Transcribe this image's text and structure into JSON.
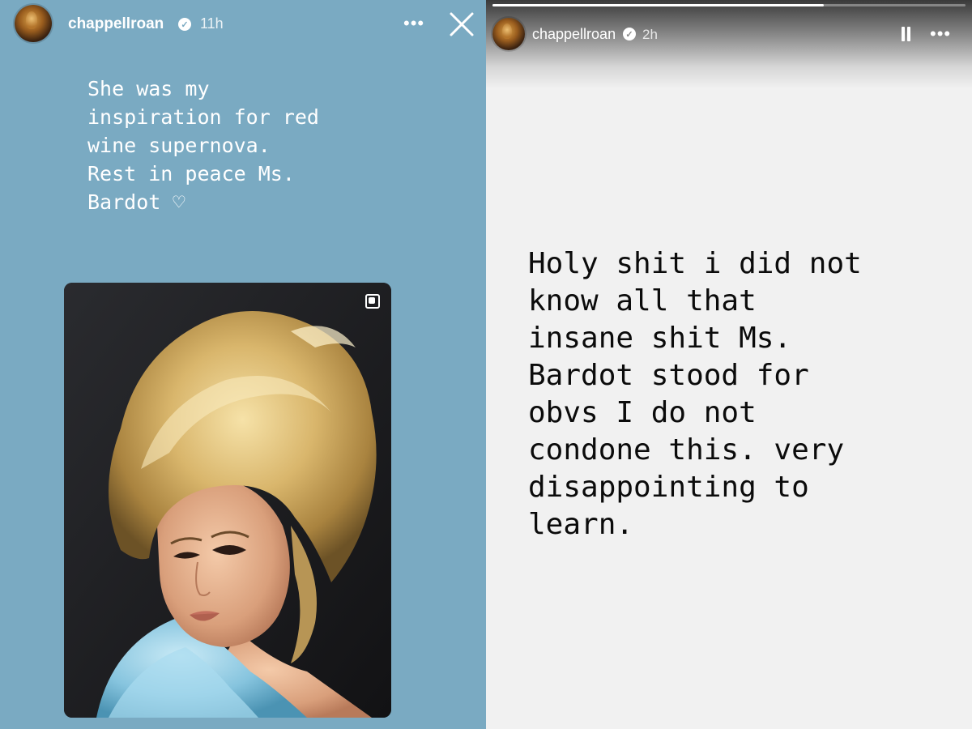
{
  "left_story": {
    "username": "chappellroan",
    "verified_icon": "verified-badge-icon",
    "time_ago": "11h",
    "more_label": "•••",
    "close_icon": "close-icon",
    "caption": "She was my\ninspiration for red\nwine supernova.\nRest in peace Ms.\nBardot ♡",
    "background_color": "#7aaac2",
    "photo": {
      "subject": "vintage portrait photo",
      "multi_photo_icon": "gallery-icon"
    }
  },
  "right_story": {
    "username": "chappellroan",
    "verified_icon": "verified-badge-icon",
    "time_ago": "2h",
    "pause_icon": "pause-icon",
    "more_label": "•••",
    "progress": 0.7,
    "caption": "Holy shit i did not\nknow all that\ninsane shit Ms.\nBardot stood for\nobvs I do not\ncondone this.  very\ndisappointing to\nlearn.",
    "background_color": "#f1f1f1"
  }
}
